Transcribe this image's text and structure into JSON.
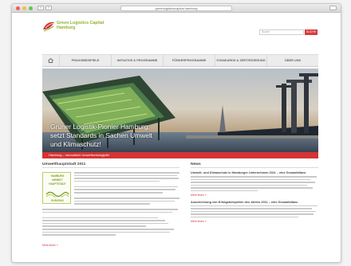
{
  "browser": {
    "url": "greenlogisticscapital.hamburg"
  },
  "site": {
    "logo": {
      "line1": "Green Logistics Capital",
      "line2": "Hamburg"
    },
    "search": {
      "placeholder": "Suche",
      "button_label": "SUCHE"
    },
    "nav": [
      {
        "label": "PRAXISBEISPIELE"
      },
      {
        "label": "INITIATIVE & PROGRAMME"
      },
      {
        "label": "FÖRDERPROGRAMME"
      },
      {
        "label": "STANDARDS & ZERTIFIZIERUNG"
      },
      {
        "label": "ÜBER UNS"
      }
    ],
    "hero": {
      "line1": "Grüner Logistik-Pionier Hamburg:",
      "line2": "setzt Standards in Sachen Umwelt",
      "line3": "und Klimaschutz!",
      "caption": "Hamburg – innovativer Umweltschutzgipfel"
    },
    "left": {
      "title": "Umwelthauptstadt 2011",
      "seal": {
        "line1": "HAMBURG",
        "line2": "UMWELT",
        "line3": "HAUPTSTADT",
        "line4": "EUROPAS"
      },
      "more": "Mehr lesen »"
    },
    "right": {
      "title": "News",
      "items": [
        {
          "title": "Umwelt- und Klimaschutz in Hamburger Unternehmen 2011 – eine Gesamtbilanz",
          "more": "Mehr lesen »"
        },
        {
          "title": "Auszeichnung von Erfolgsbeispielen des Jahres 2011 – eine Gesamtbilanz",
          "more": "Mehr lesen »"
        }
      ]
    }
  },
  "colors": {
    "accent_red": "#d43434",
    "logo_green": "#8fb32c"
  }
}
